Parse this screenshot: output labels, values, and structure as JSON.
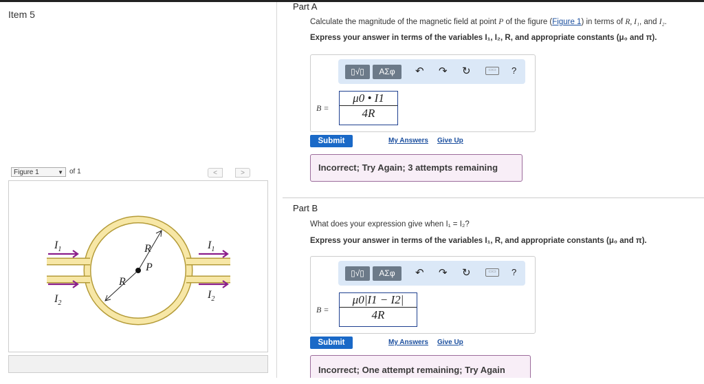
{
  "item_title": "Item 5",
  "figure_nav": {
    "selected": "Figure 1",
    "of_text": "of 1",
    "prev": "<",
    "next": ">"
  },
  "figure": {
    "I1": "I",
    "I1_sub": "1",
    "I2": "I",
    "I2_sub": "2",
    "R": "R",
    "P": "P",
    "colors": {
      "ring": "#f7e7a6",
      "ring_edge": "#b49b38",
      "arrow": "#8b1e8b",
      "wire": "#222222"
    }
  },
  "part_a": {
    "title": "Part A",
    "question": "Calculate the magnitude of the magnetic field at point P of the figure (Figure 1) in terms of R, I₁, and I₂.",
    "question_parts": {
      "pre": "Calculate the magnitude of the magnetic field at point ",
      "P": "P",
      "mid": " of the figure (",
      "link": "Figure 1",
      "post": ") in terms of ",
      "vars": "R, I₁",
      ", and": ", and ",
      "I2": "I₂",
      "end": "."
    },
    "instructions": "Express your answer in terms of the variables I₁, I₂, R, and appropriate constants (μ₀ and π).",
    "toolbar": {
      "template": "▯√▯",
      "greek": "ΑΣφ",
      "undo": "↶",
      "redo": "↷",
      "reset": "↻",
      "keyboard": "kbd",
      "help": "?"
    },
    "b_label": "B =",
    "answer_num": "μ0 • I1",
    "answer_den": "4R",
    "submit": "Submit",
    "my_answers": "My Answers",
    "give_up": "Give Up",
    "feedback": "Incorrect; Try Again; 3 attempts remaining"
  },
  "part_b": {
    "title": "Part B",
    "question": "What does your expression give when I₁ = I₂?",
    "instructions": "Express your answer in terms of the variables I₁, R, and appropriate constants (μ₀ and π).",
    "toolbar": {
      "template": "▯√▯",
      "greek": "ΑΣφ",
      "undo": "↶",
      "redo": "↷",
      "reset": "↻",
      "keyboard": "kbd",
      "help": "?"
    },
    "b_label": "B =",
    "answer_num": "μ0|I1 − I2|",
    "answer_den": "4R",
    "submit": "Submit",
    "my_answers": "My Answers",
    "give_up": "Give Up",
    "feedback": "Incorrect; One attempt remaining; Try Again"
  },
  "colors": {
    "accent": "#1a69c7",
    "feedback_bg": "#f8eef7",
    "feedback_border": "#9b6b9b",
    "toolbar_bg": "#dbe8f7"
  }
}
